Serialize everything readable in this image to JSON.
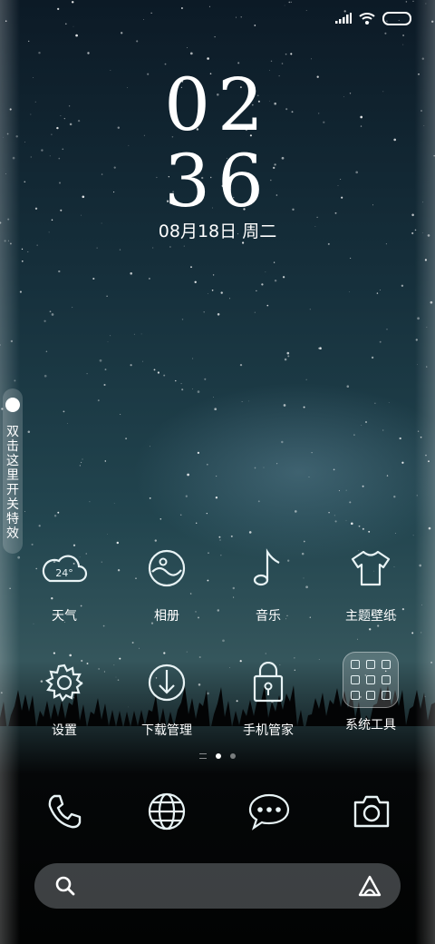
{
  "status_bar": {
    "icons": [
      "signal-icon",
      "wifi-icon",
      "battery-icon"
    ]
  },
  "clock": {
    "hour": "02",
    "minute": "36",
    "date": "08月18日 周二"
  },
  "side_toggle": {
    "text": "双击这里开关特效"
  },
  "apps_row1": [
    {
      "label": "天气",
      "icon": "weather-cloud-icon",
      "badge": "24°"
    },
    {
      "label": "相册",
      "icon": "gallery-icon"
    },
    {
      "label": "音乐",
      "icon": "music-note-icon"
    },
    {
      "label": "主题壁纸",
      "icon": "tshirt-icon"
    }
  ],
  "apps_row2": [
    {
      "label": "设置",
      "icon": "gear-icon"
    },
    {
      "label": "下载管理",
      "icon": "download-icon"
    },
    {
      "label": "手机管家",
      "icon": "lock-shield-icon"
    },
    {
      "label": "系统工具",
      "icon": "folder-icon"
    }
  ],
  "page_indicator": {
    "pages": 2,
    "current": 1
  },
  "dock": [
    {
      "icon": "phone-icon"
    },
    {
      "icon": "browser-globe-icon"
    },
    {
      "icon": "messages-icon"
    },
    {
      "icon": "camera-icon"
    }
  ],
  "search_bar": {
    "left_icon": "search-icon",
    "right_icon": "assistant-icon"
  }
}
